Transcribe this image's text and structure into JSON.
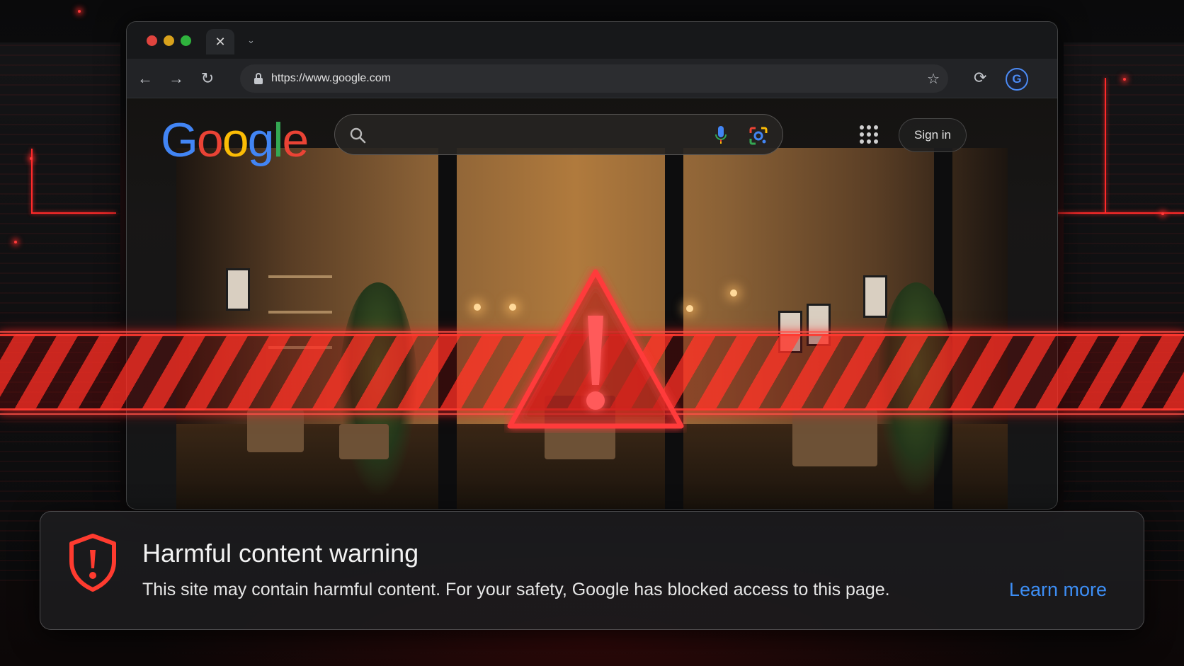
{
  "browser": {
    "tab": {
      "close_icon": "close-icon"
    },
    "address_bar": {
      "url": "https://www.google.com"
    },
    "profile": {
      "initial": "G"
    }
  },
  "page": {
    "logo": {
      "letters": [
        "G",
        "o",
        "o",
        "g",
        "l",
        "e"
      ]
    },
    "search": {
      "placeholder": ""
    },
    "sign_in_label": "Sign in"
  },
  "warning": {
    "title": "Harmful content warning",
    "message": "This site may contain harmful content. For your safety, Google has blocked access to this page.",
    "link_label": "Learn more"
  },
  "colors": {
    "warning_red": "#ff2a2a",
    "link_blue": "#3d8ef5",
    "google_blue": "#4285f4",
    "google_red": "#ea4335",
    "google_yellow": "#fbbc05",
    "google_green": "#34a853"
  }
}
